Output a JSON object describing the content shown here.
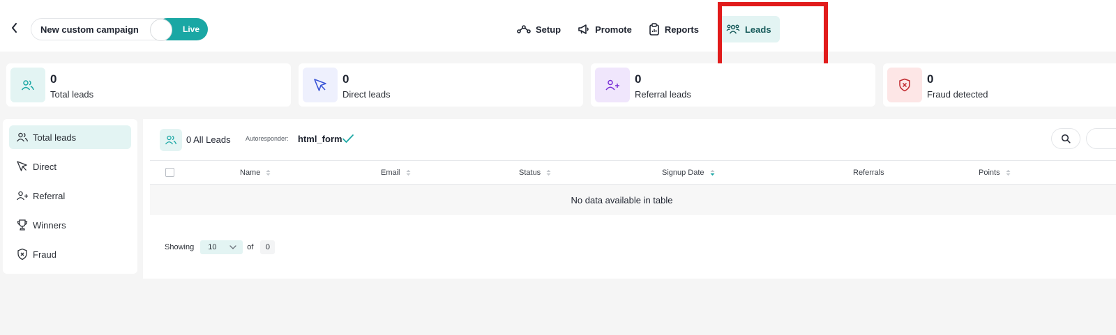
{
  "header": {
    "campaign_name": "New custom campaign",
    "live_label": "Live",
    "nav": [
      {
        "label": "Setup",
        "icon": "setup-icon"
      },
      {
        "label": "Promote",
        "icon": "megaphone-icon"
      },
      {
        "label": "Reports",
        "icon": "clipboard-icon"
      },
      {
        "label": "Leads",
        "icon": "users-icon",
        "active": true
      }
    ]
  },
  "stats": [
    {
      "value": "0",
      "label": "Total leads",
      "icon": "users-icon",
      "color": "#e3f4f3"
    },
    {
      "value": "0",
      "label": "Direct leads",
      "icon": "cursor-icon",
      "color": "#eef0fd"
    },
    {
      "value": "0",
      "label": "Referral leads",
      "icon": "user-plus-icon",
      "color": "#f0e6fc"
    },
    {
      "value": "0",
      "label": "Fraud detected",
      "icon": "shield-x-icon",
      "color": "#fde6e6"
    }
  ],
  "sidebar": {
    "items": [
      {
        "label": "Total leads",
        "icon": "users-icon",
        "active": true
      },
      {
        "label": "Direct",
        "icon": "cursor-icon"
      },
      {
        "label": "Referral",
        "icon": "user-plus-icon"
      },
      {
        "label": "Winners",
        "icon": "trophy-icon"
      },
      {
        "label": "Fraud",
        "icon": "shield-x-icon"
      }
    ]
  },
  "main": {
    "all_leads": "0 All Leads",
    "autoresponder_label": "Autoresponder:",
    "autoresponder_value": "html_form",
    "columns": [
      "Name",
      "Email",
      "Status",
      "Signup Date",
      "Referrals",
      "Points"
    ],
    "empty_message": "No data available in table",
    "pager": {
      "showing_label": "Showing",
      "page_size": "10",
      "of_label": "of",
      "total": "0"
    }
  },
  "colors": {
    "accent": "#1aa7a4",
    "highlight": "#e11b1b"
  }
}
